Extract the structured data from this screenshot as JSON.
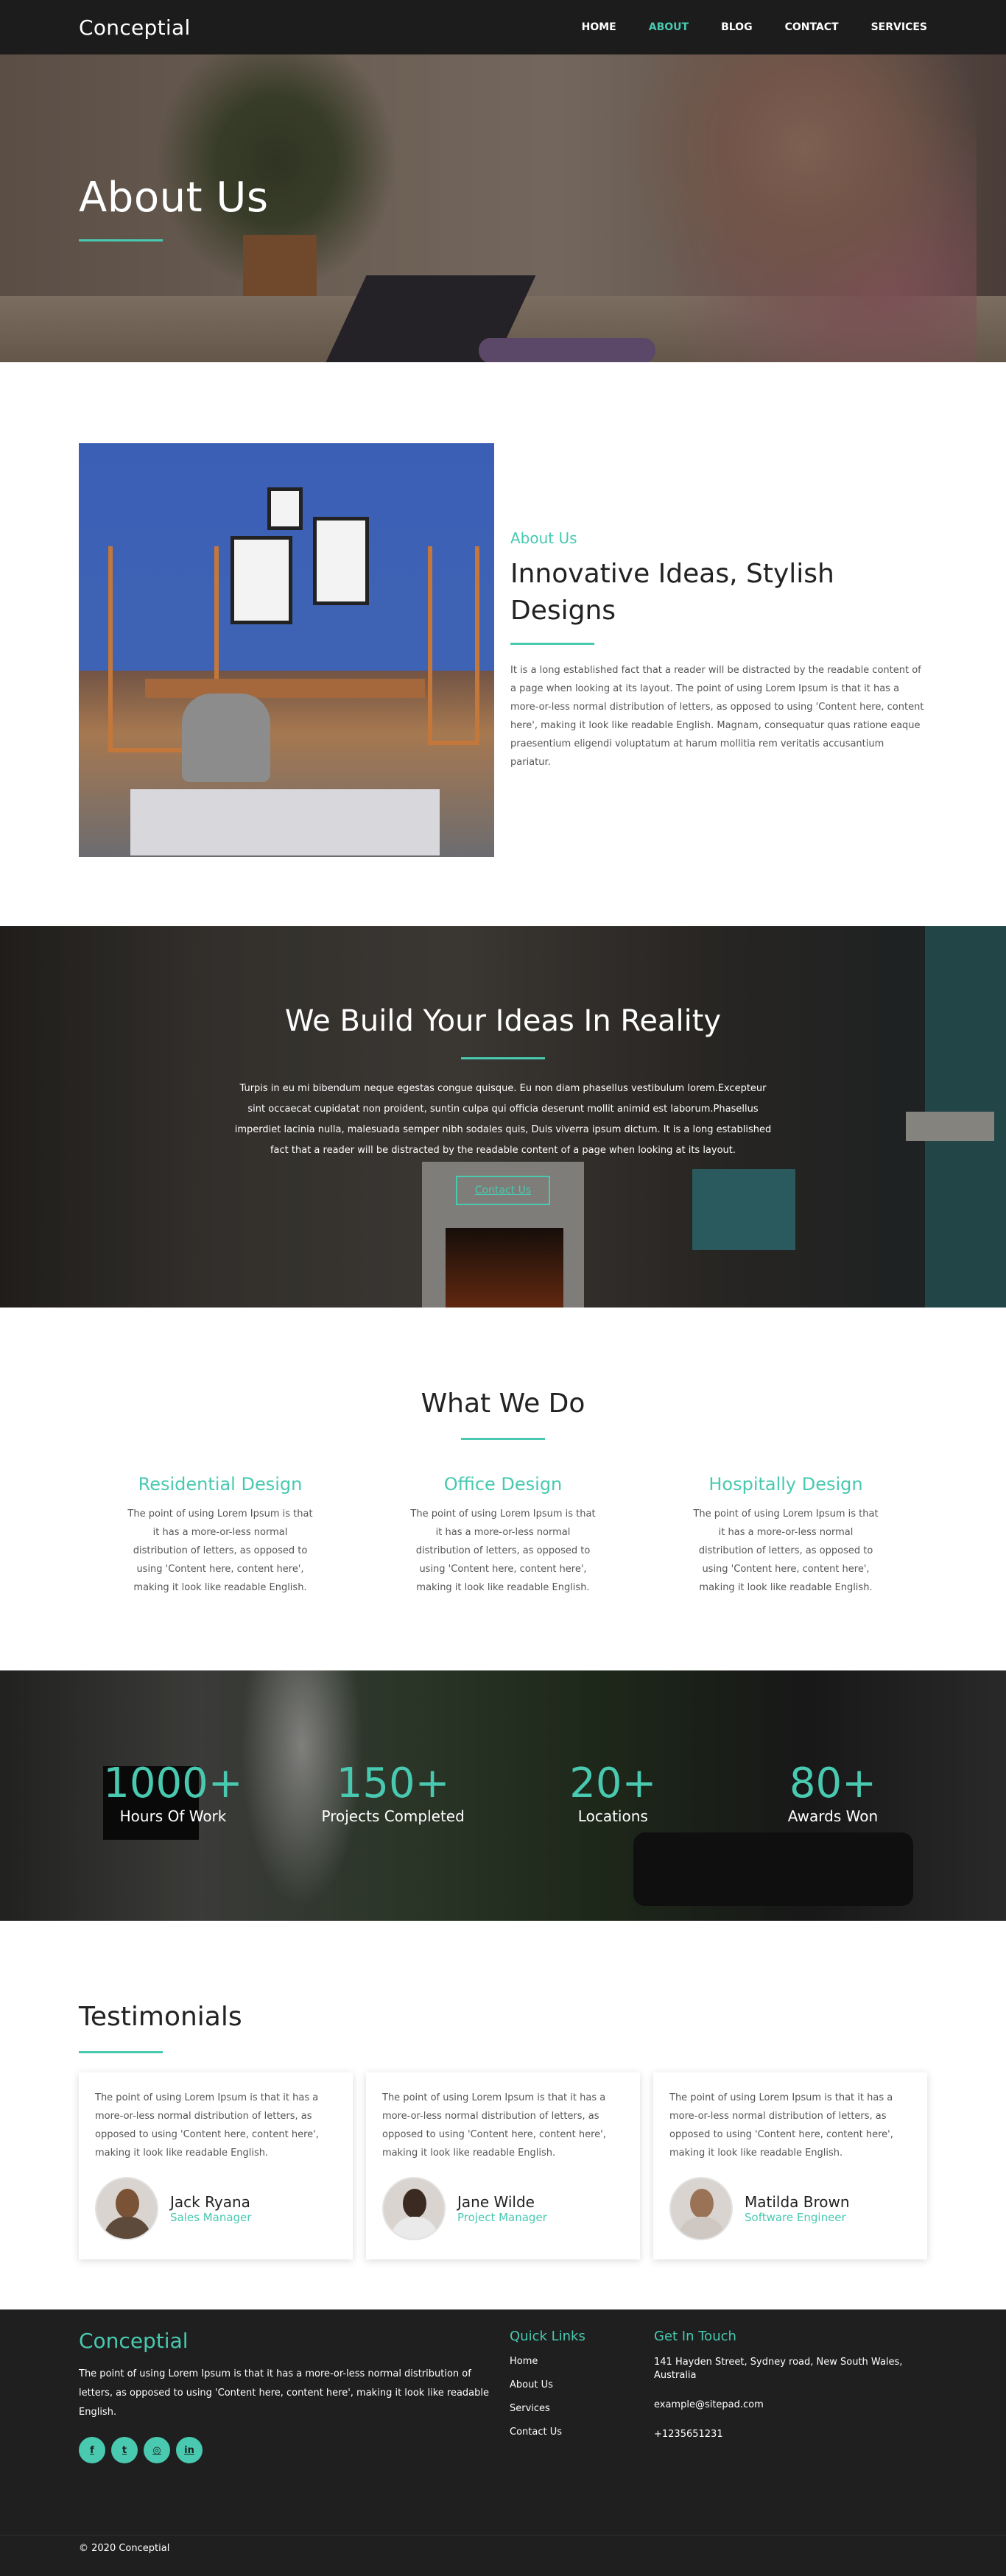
{
  "header": {
    "logo": "Conceptial",
    "nav": [
      {
        "label": "HOME"
      },
      {
        "label": "ABOUT"
      },
      {
        "label": "BLOG"
      },
      {
        "label": "CONTACT"
      },
      {
        "label": "SERVICES"
      }
    ],
    "active_nav": "ABOUT"
  },
  "hero": {
    "title": "About Us"
  },
  "about": {
    "kicker": "About Us",
    "title": "Innovative Ideas, Stylish Designs",
    "body": "It is a long established fact that a reader will be distracted by the readable content of a page when looking at its layout. The point of using Lorem Ipsum is that it has a more-or-less normal distribution of letters, as opposed to using 'Content here, content here', making it look like readable English. Magnam, consequatur quas ratione eaque praesentium eligendi voluptatum at harum mollitia rem veritatis accusantium pariatur."
  },
  "build": {
    "title": "We Build Your Ideas In Reality",
    "body": "Turpis in eu mi bibendum neque egestas congue quisque. Eu non diam phasellus vestibulum lorem.Excepteur sint occaecat cupidatat non proident, suntin culpa qui officia deserunt mollit animid est laborum.Phasellus imperdiet lacinia nulla, malesuada semper nibh sodales quis, Duis viverra ipsum dictum. It is a long established fact that a reader will be distracted by the readable content of a page when looking at its layout.",
    "button": "Contact Us"
  },
  "what": {
    "title": "What We Do",
    "items": [
      {
        "title": "Residential Design",
        "body": "The point of using Lorem Ipsum is that it has a more-or-less normal distribution of letters, as opposed to using 'Content here, content here', making it look like readable English."
      },
      {
        "title": "Office Design",
        "body": "The point of using Lorem Ipsum is that it has a more-or-less normal distribution of letters, as opposed to using 'Content here, content here', making it look like readable English."
      },
      {
        "title": "Hospitally Design",
        "body": "The point of using Lorem Ipsum is that it has a more-or-less normal distribution of letters, as opposed to using 'Content here, content here', making it look like readable English."
      }
    ]
  },
  "stats": [
    {
      "value": "1000+",
      "label": "Hours Of Work"
    },
    {
      "value": "150+",
      "label": "Projects Completed"
    },
    {
      "value": "20+",
      "label": "Locations"
    },
    {
      "value": "80+",
      "label": "Awards Won"
    }
  ],
  "testimonials": {
    "title": "Testimonials",
    "items": [
      {
        "quote": "The point of using Lorem Ipsum is that it has a more-or-less normal distribution of letters, as opposed to using 'Content here, content here', making it look like readable English.",
        "name": "Jack Ryana",
        "role": "Sales Manager"
      },
      {
        "quote": "The point of using Lorem Ipsum is that it has a more-or-less normal distribution of letters, as opposed to using 'Content here, content here', making it look like readable English.",
        "name": "Jane Wilde",
        "role": "Project Manager"
      },
      {
        "quote": "The point of using Lorem Ipsum is that it has a more-or-less normal distribution of letters, as opposed to using 'Content here, content here', making it look like readable English.",
        "name": "Matilda Brown",
        "role": "Software Engineer"
      }
    ]
  },
  "footer": {
    "logo": "Conceptial",
    "about": "The point of using Lorem Ipsum is that it has a more-or-less normal distribution of letters, as opposed to using 'Content here, content here', making it look like readable English.",
    "socials": [
      {
        "icon": "facebook-icon",
        "glyph": "f"
      },
      {
        "icon": "twitter-icon",
        "glyph": "t"
      },
      {
        "icon": "instagram-icon",
        "glyph": "◎"
      },
      {
        "icon": "linkedin-icon",
        "glyph": "in"
      }
    ],
    "quick_links_title": "Quick Links",
    "quick_links": [
      "Home",
      "About Us",
      "Services",
      "Contact Us"
    ],
    "contact_title": "Get In Touch",
    "address": "141 Hayden Street, Sydney road, New South Wales, Australia",
    "email": "example@sitepad.com",
    "phone": "+1235651231",
    "copyright": "© 2020 Conceptial"
  },
  "colors": {
    "accent": "#48c9b0",
    "dark": "#1c1c1c"
  }
}
